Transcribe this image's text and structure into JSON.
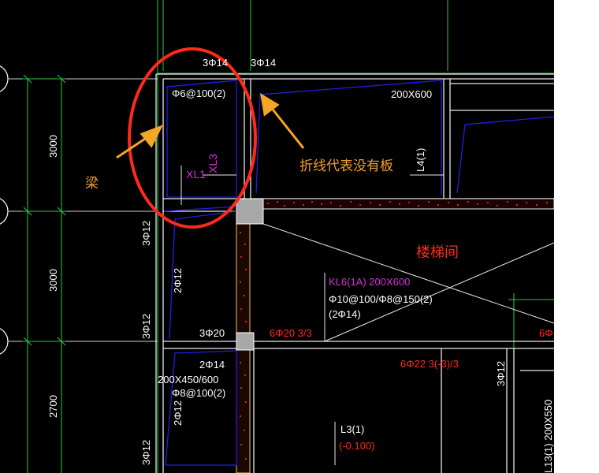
{
  "texts": {
    "top_rebar_1": "3Φ14",
    "top_rebar_2": "3Φ14",
    "stirrup_xl1": "Φ6@100(2)",
    "beam_size_top": "200X600",
    "xl3": "XL3",
    "xl1": "XL1",
    "l4": "L4(1)",
    "dim_3000_a": "3000",
    "dim_3000_b": "3000",
    "dim_2700": "2700",
    "label_beam": "梁",
    "label_fold_line": "折线代表没有板",
    "stair_room": "楼梯间",
    "left_3phi12_a": "3Φ12",
    "left_3phi12_b": "3Φ12",
    "left_3phi12_c": "3Φ12",
    "left_2phi12": "2Φ12",
    "left_2phi12_b": "2Φ12",
    "kl6_name": "KL6(1A) 200X600",
    "kl6_stirrup": "Φ10@100/Φ8@150(2)",
    "kl6_side": "(2Φ14)",
    "bot_3phi20": "3Φ20",
    "red_6phi20": "6Φ20 3/3",
    "red_6phi22": "6Φ22 3(-3)/3",
    "red_6phi_edge": "6Φ",
    "mid_2phi14": "2Φ14",
    "size_200x450": "200X450/600",
    "stirrup_phi8": "Φ8@100(2)",
    "l3_name": "L3(1)",
    "l3_elev": "(-0.100)",
    "right_3phi12": "3Φ12",
    "right_l13": "L13(1) 200X550"
  },
  "colors": {
    "background": "#000000",
    "annotation_red": "#ff2a1a",
    "arrow_orange": "#f5a623",
    "text_orange": "#f0a030",
    "beam_blue": "#2020d8",
    "green": "#22cc44",
    "magenta": "#d830d8",
    "white": "#ffffff"
  }
}
